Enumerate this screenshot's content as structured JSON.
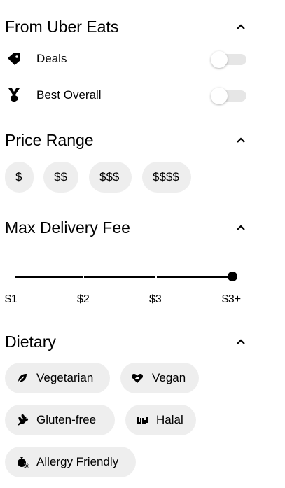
{
  "sections": {
    "uber_eats": {
      "title": "From Uber Eats",
      "expanded": true,
      "toggles": [
        {
          "label": "Deals",
          "icon": "tag-icon",
          "on": false
        },
        {
          "label": "Best Overall",
          "icon": "medal-icon",
          "on": false
        }
      ]
    },
    "price_range": {
      "title": "Price Range",
      "expanded": true,
      "options": [
        "$",
        "$$",
        "$$$",
        "$$$$"
      ]
    },
    "delivery_fee": {
      "title": "Max Delivery Fee",
      "expanded": true,
      "labels": [
        "$1",
        "$2",
        "$3",
        "$3+"
      ],
      "selected": "$3+"
    },
    "dietary": {
      "title": "Dietary",
      "expanded": true,
      "options": [
        {
          "label": "Vegetarian",
          "icon": "leaf-icon"
        },
        {
          "label": "Vegan",
          "icon": "heart-leaf-icon"
        },
        {
          "label": "Gluten-free",
          "icon": "wheat-icon"
        },
        {
          "label": "Halal",
          "icon": "halal-icon"
        },
        {
          "label": "Allergy Friendly",
          "icon": "allergen-icon"
        }
      ]
    }
  },
  "colors": {
    "text": "#000000",
    "pill_bg": "#eeeeee",
    "switch_track": "#e6e6e6",
    "accent": "#000000"
  }
}
